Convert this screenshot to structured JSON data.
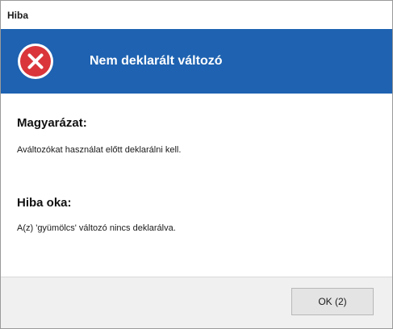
{
  "window": {
    "title": "Hiba"
  },
  "header": {
    "icon": "error-x-icon",
    "heading": "Nem deklarált változó",
    "accent_color": "#1e62b1",
    "icon_color": "#d9353b"
  },
  "sections": [
    {
      "title": "Magyarázat:",
      "text": "Aváltozókat használat előtt deklarálni kell."
    },
    {
      "title": "Hiba oka:",
      "text": "A(z) 'gyümölcs' változó nincs deklarálva."
    }
  ],
  "footer": {
    "ok_label": "OK (2)"
  }
}
